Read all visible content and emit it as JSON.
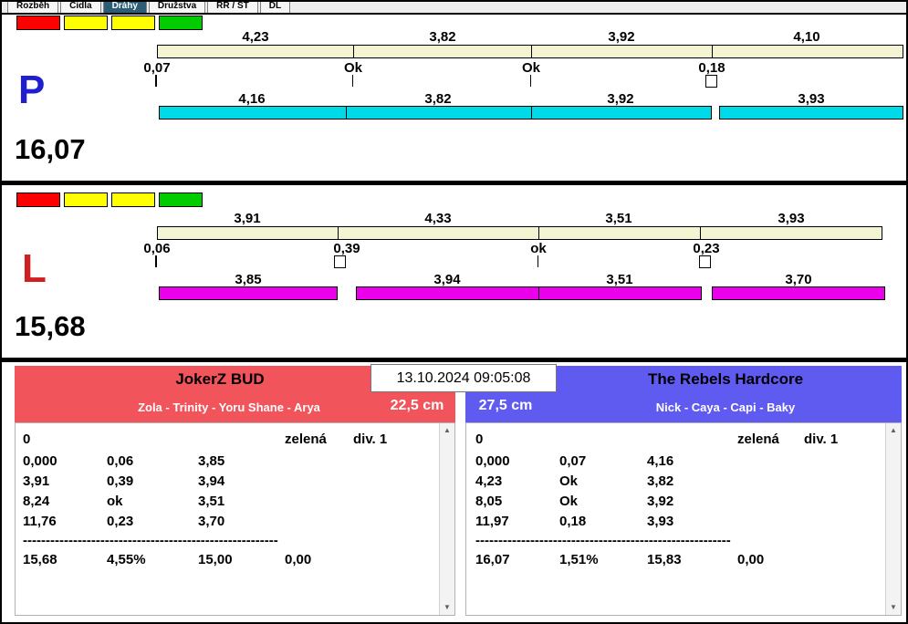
{
  "tabs": {
    "items": [
      {
        "label": "Rozběh",
        "selected": false
      },
      {
        "label": "Čidla",
        "selected": false
      },
      {
        "label": "Dráhy",
        "selected": true
      },
      {
        "label": "Družstva",
        "selected": false
      },
      {
        "label": "RR / ST",
        "selected": false
      },
      {
        "label": "DL",
        "selected": false
      }
    ]
  },
  "lanes": {
    "p": {
      "letter": "P",
      "letter_color": "#1f1fd0",
      "total": "16,07",
      "status_colors": [
        "#ff0000",
        "#ffff00",
        "#ffff00",
        "#00cc00"
      ],
      "bar_color": "#00d9e8",
      "split_times": [
        "4,23",
        "3,82",
        "3,92",
        "4,10"
      ],
      "cross_times": [
        "0,07",
        "Ok",
        "Ok",
        "0,18"
      ],
      "run_times": [
        "4,16",
        "3,82",
        "3,92",
        "3,93"
      ]
    },
    "l": {
      "letter": "L",
      "letter_color": "#d01f1f",
      "total": "15,68",
      "status_colors": [
        "#ff0000",
        "#ffff00",
        "#ffff00",
        "#00cc00"
      ],
      "bar_color": "#ea00ea",
      "split_times": [
        "3,91",
        "4,33",
        "3,51",
        "3,93"
      ],
      "cross_times": [
        "0,06",
        "0,39",
        "ok",
        "0,23"
      ],
      "run_times": [
        "3,85",
        "3,94",
        "3,51",
        "3,70"
      ]
    }
  },
  "datetime": "13.10.2024 09:05:08",
  "teams": {
    "left": {
      "name": "JokerZ BUD",
      "members": "Zola - Trinity - Yoru Shane - Arya",
      "jump_height": "22,5 cm",
      "color": "#f2545b",
      "table": {
        "run_no": "0",
        "color_name": "zelená",
        "division": "div. 1",
        "rows": [
          [
            "0,000",
            "0,06",
            "3,85"
          ],
          [
            "3,91",
            "0,39",
            "3,94"
          ],
          [
            "8,24",
            "ok",
            "3,51"
          ],
          [
            "11,76",
            "0,23",
            "3,70"
          ]
        ],
        "separator": "--------------------------------------------------------",
        "totals": [
          "15,68",
          "4,55%",
          "15,00",
          "0,00"
        ]
      }
    },
    "right": {
      "name": "The Rebels Hardcore",
      "members": "Nick - Caya - Capi - Baky",
      "jump_height": "27,5 cm",
      "color": "#5f5af0",
      "table": {
        "run_no": "0",
        "color_name": "zelená",
        "division": "div. 1",
        "rows": [
          [
            "0,000",
            "0,07",
            "4,16"
          ],
          [
            "4,23",
            "Ok",
            "3,82"
          ],
          [
            "8,05",
            "Ok",
            "3,92"
          ],
          [
            "11,97",
            "0,18",
            "3,93"
          ]
        ],
        "separator": "--------------------------------------------------------",
        "totals": [
          "16,07",
          "1,51%",
          "15,83",
          "0,00"
        ]
      }
    }
  },
  "scrollbar": {
    "up": "▲",
    "down": "▼"
  }
}
